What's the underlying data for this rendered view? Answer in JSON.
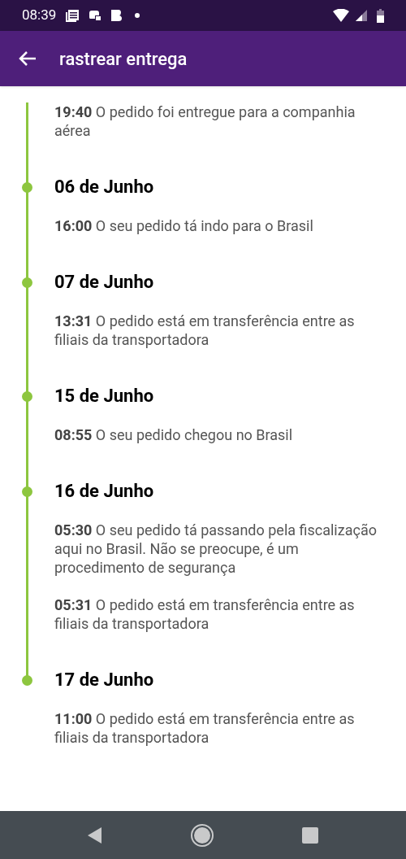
{
  "status_bar": {
    "time": "08:39"
  },
  "app_bar": {
    "title": "rastrear entrega"
  },
  "timeline": [
    {
      "events": [
        "**19:40** O pedido foi entregue para a companhia aérea"
      ]
    },
    {
      "date": "06 de Junho",
      "events": [
        "**16:00** O seu pedido tá indo para o Brasil"
      ]
    },
    {
      "date": "07 de Junho",
      "events": [
        "**13:31** O pedido está em transferência entre as filiais da transportadora"
      ]
    },
    {
      "date": "15 de Junho",
      "events": [
        "**08:55** O seu pedido chegou no Brasil"
      ]
    },
    {
      "date": "16 de Junho",
      "events": [
        "**05:30** O seu pedido tá passando pela fiscalização aqui no Brasil. Não se preocupe, é um procedimento de segurança",
        "**05:31** O pedido está em transferência entre as filiais da transportadora"
      ]
    },
    {
      "date": "17 de Junho",
      "events": [
        "**11:00** O pedido está em transferência entre as filiais da transportadora"
      ]
    }
  ]
}
